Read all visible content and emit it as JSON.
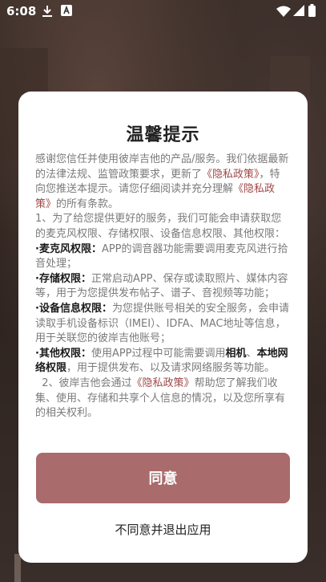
{
  "status_bar": {
    "time": "6:08",
    "icons": [
      "download-icon",
      "font-a-icon",
      "wifi-icon",
      "signal-icon",
      "battery-icon"
    ]
  },
  "dialog": {
    "title": "温馨提示",
    "intro_prefix": "感谢您信任并使用彼岸吉他的产品/服务。我们依据最新的法律法规、监管政策要求，更新了",
    "privacy_link_1": "《隐私政策》",
    "intro_middle": "，特向您推送本提示。请您仔细阅读并充分理解",
    "privacy_link_2": "《隐私政策》",
    "intro_suffix": "的所有条款。",
    "section1": "1、为了给您提供更好的服务，我们可能会申请获取您的麦克风权限、存储权限、设备信息权限、其他权限：",
    "mic_label": "·麦克风权限：",
    "mic_text": "APP的调音器功能需要调用麦克风进行拾音处理；",
    "storage_label": "·存储权限：",
    "storage_text": "正常启动APP、保存或读取照片、媒体内容等，用于为您提供发布帖子、谱子、音视频等功能；",
    "device_label": "·设备信息权限：",
    "device_text": "为您提供账号相关的安全服务，会申请读取手机设备标识（IMEI）、IDFA、MAC地址等信息，用于关联您的彼岸吉他账号；",
    "other_label": "·其他权限：",
    "other_text_1": "使用APP过程中可能需要调用",
    "other_bold_1": "相机",
    "other_text_2": "、",
    "other_bold_2": "本地网络权限",
    "other_text_3": "，用于提供发布、以及请求网络服务等功能。",
    "section2_prefix": "2、彼岸吉他会通过",
    "privacy_link_3": "《隐私政策》",
    "section2_suffix": "帮助您了解我们收集、使用、存储和共享个人信息的情况，以及您所享有的相关权利。",
    "agree_label": "同意",
    "decline_label": "不同意并退出应用"
  },
  "colors": {
    "accent": "#a96b6b",
    "link": "#a04848",
    "body_text": "#7a7a7a"
  }
}
